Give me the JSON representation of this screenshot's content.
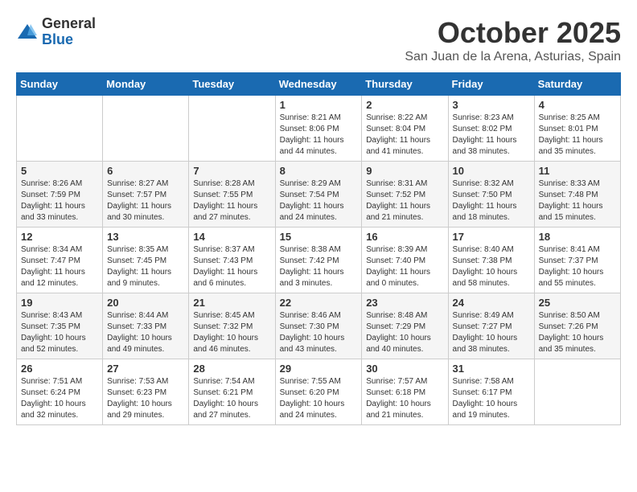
{
  "header": {
    "logo_general": "General",
    "logo_blue": "Blue",
    "month_title": "October 2025",
    "location": "San Juan de la Arena, Asturias, Spain"
  },
  "days_of_week": [
    "Sunday",
    "Monday",
    "Tuesday",
    "Wednesday",
    "Thursday",
    "Friday",
    "Saturday"
  ],
  "weeks": [
    [
      {
        "day": "",
        "info": ""
      },
      {
        "day": "",
        "info": ""
      },
      {
        "day": "",
        "info": ""
      },
      {
        "day": "1",
        "info": "Sunrise: 8:21 AM\nSunset: 8:06 PM\nDaylight: 11 hours\nand 44 minutes."
      },
      {
        "day": "2",
        "info": "Sunrise: 8:22 AM\nSunset: 8:04 PM\nDaylight: 11 hours\nand 41 minutes."
      },
      {
        "day": "3",
        "info": "Sunrise: 8:23 AM\nSunset: 8:02 PM\nDaylight: 11 hours\nand 38 minutes."
      },
      {
        "day": "4",
        "info": "Sunrise: 8:25 AM\nSunset: 8:01 PM\nDaylight: 11 hours\nand 35 minutes."
      }
    ],
    [
      {
        "day": "5",
        "info": "Sunrise: 8:26 AM\nSunset: 7:59 PM\nDaylight: 11 hours\nand 33 minutes."
      },
      {
        "day": "6",
        "info": "Sunrise: 8:27 AM\nSunset: 7:57 PM\nDaylight: 11 hours\nand 30 minutes."
      },
      {
        "day": "7",
        "info": "Sunrise: 8:28 AM\nSunset: 7:55 PM\nDaylight: 11 hours\nand 27 minutes."
      },
      {
        "day": "8",
        "info": "Sunrise: 8:29 AM\nSunset: 7:54 PM\nDaylight: 11 hours\nand 24 minutes."
      },
      {
        "day": "9",
        "info": "Sunrise: 8:31 AM\nSunset: 7:52 PM\nDaylight: 11 hours\nand 21 minutes."
      },
      {
        "day": "10",
        "info": "Sunrise: 8:32 AM\nSunset: 7:50 PM\nDaylight: 11 hours\nand 18 minutes."
      },
      {
        "day": "11",
        "info": "Sunrise: 8:33 AM\nSunset: 7:48 PM\nDaylight: 11 hours\nand 15 minutes."
      }
    ],
    [
      {
        "day": "12",
        "info": "Sunrise: 8:34 AM\nSunset: 7:47 PM\nDaylight: 11 hours\nand 12 minutes."
      },
      {
        "day": "13",
        "info": "Sunrise: 8:35 AM\nSunset: 7:45 PM\nDaylight: 11 hours\nand 9 minutes."
      },
      {
        "day": "14",
        "info": "Sunrise: 8:37 AM\nSunset: 7:43 PM\nDaylight: 11 hours\nand 6 minutes."
      },
      {
        "day": "15",
        "info": "Sunrise: 8:38 AM\nSunset: 7:42 PM\nDaylight: 11 hours\nand 3 minutes."
      },
      {
        "day": "16",
        "info": "Sunrise: 8:39 AM\nSunset: 7:40 PM\nDaylight: 11 hours\nand 0 minutes."
      },
      {
        "day": "17",
        "info": "Sunrise: 8:40 AM\nSunset: 7:38 PM\nDaylight: 10 hours\nand 58 minutes."
      },
      {
        "day": "18",
        "info": "Sunrise: 8:41 AM\nSunset: 7:37 PM\nDaylight: 10 hours\nand 55 minutes."
      }
    ],
    [
      {
        "day": "19",
        "info": "Sunrise: 8:43 AM\nSunset: 7:35 PM\nDaylight: 10 hours\nand 52 minutes."
      },
      {
        "day": "20",
        "info": "Sunrise: 8:44 AM\nSunset: 7:33 PM\nDaylight: 10 hours\nand 49 minutes."
      },
      {
        "day": "21",
        "info": "Sunrise: 8:45 AM\nSunset: 7:32 PM\nDaylight: 10 hours\nand 46 minutes."
      },
      {
        "day": "22",
        "info": "Sunrise: 8:46 AM\nSunset: 7:30 PM\nDaylight: 10 hours\nand 43 minutes."
      },
      {
        "day": "23",
        "info": "Sunrise: 8:48 AM\nSunset: 7:29 PM\nDaylight: 10 hours\nand 40 minutes."
      },
      {
        "day": "24",
        "info": "Sunrise: 8:49 AM\nSunset: 7:27 PM\nDaylight: 10 hours\nand 38 minutes."
      },
      {
        "day": "25",
        "info": "Sunrise: 8:50 AM\nSunset: 7:26 PM\nDaylight: 10 hours\nand 35 minutes."
      }
    ],
    [
      {
        "day": "26",
        "info": "Sunrise: 7:51 AM\nSunset: 6:24 PM\nDaylight: 10 hours\nand 32 minutes."
      },
      {
        "day": "27",
        "info": "Sunrise: 7:53 AM\nSunset: 6:23 PM\nDaylight: 10 hours\nand 29 minutes."
      },
      {
        "day": "28",
        "info": "Sunrise: 7:54 AM\nSunset: 6:21 PM\nDaylight: 10 hours\nand 27 minutes."
      },
      {
        "day": "29",
        "info": "Sunrise: 7:55 AM\nSunset: 6:20 PM\nDaylight: 10 hours\nand 24 minutes."
      },
      {
        "day": "30",
        "info": "Sunrise: 7:57 AM\nSunset: 6:18 PM\nDaylight: 10 hours\nand 21 minutes."
      },
      {
        "day": "31",
        "info": "Sunrise: 7:58 AM\nSunset: 6:17 PM\nDaylight: 10 hours\nand 19 minutes."
      },
      {
        "day": "",
        "info": ""
      }
    ]
  ]
}
